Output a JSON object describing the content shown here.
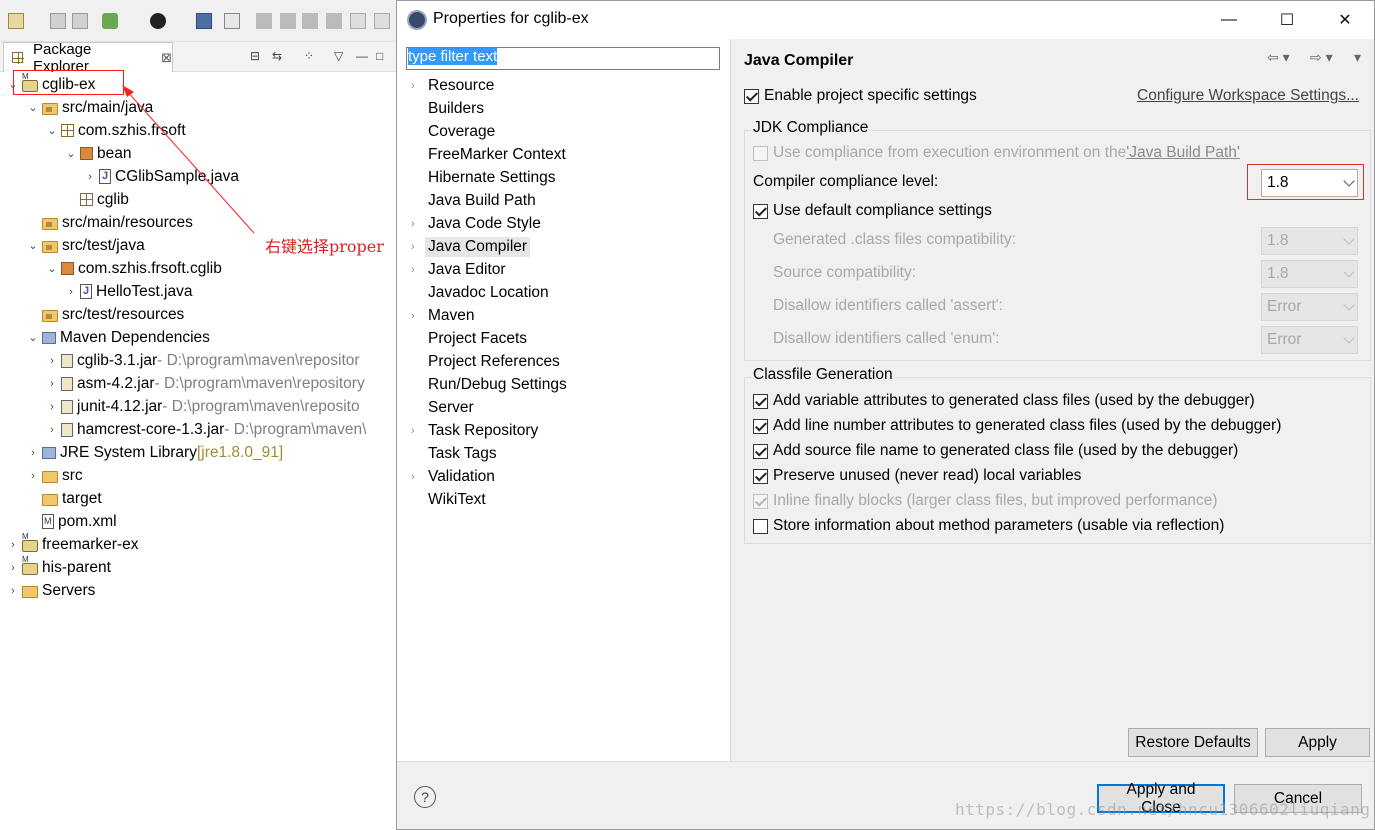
{
  "package_explorer": {
    "title": "Package Explorer",
    "close_glyph": "⊠",
    "tree": [
      {
        "label": "cglib-ex",
        "icon": "maven-project-icon",
        "twisty": "⌄"
      },
      {
        "label": "src/main/java",
        "icon": "source-folder-icon",
        "twisty": "⌄"
      },
      {
        "label": "com.szhis.frsoft",
        "icon": "package-icon",
        "twisty": "⌄"
      },
      {
        "label": "bean",
        "icon": "package-icon",
        "twisty": "⌄"
      },
      {
        "label": "CGlibSample.java",
        "icon": "java-file-icon",
        "twisty": "›"
      },
      {
        "label": "cglib",
        "icon": "package-icon",
        "twisty": ""
      },
      {
        "label": "src/main/resources",
        "icon": "source-folder-icon",
        "twisty": ""
      },
      {
        "label": "src/test/java",
        "icon": "source-folder-icon",
        "twisty": "⌄"
      },
      {
        "label": "com.szhis.frsoft.cglib",
        "icon": "package-icon",
        "twisty": "⌄"
      },
      {
        "label": "HelloTest.java",
        "icon": "java-file-icon",
        "twisty": "›"
      },
      {
        "label": "src/test/resources",
        "icon": "source-folder-icon",
        "twisty": ""
      },
      {
        "label": "Maven Dependencies",
        "icon": "library-icon",
        "twisty": "⌄"
      },
      {
        "label": "cglib-3.1.jar",
        "deco": " - D:\\program\\maven\\repositor",
        "icon": "jar-icon",
        "twisty": "›"
      },
      {
        "label": "asm-4.2.jar",
        "deco": " - D:\\program\\maven\\repository",
        "icon": "jar-icon",
        "twisty": "›"
      },
      {
        "label": "junit-4.12.jar",
        "deco": " - D:\\program\\maven\\reposito",
        "icon": "jar-icon",
        "twisty": "›"
      },
      {
        "label": "hamcrest-core-1.3.jar",
        "deco": " - D:\\program\\maven\\",
        "icon": "jar-icon",
        "twisty": "›"
      },
      {
        "label": "JRE System Library",
        "deco": " [jre1.8.0_91]",
        "icon": "library-icon",
        "twisty": "›"
      },
      {
        "label": "src",
        "icon": "folder-icon",
        "twisty": "›"
      },
      {
        "label": "target",
        "icon": "folder-icon",
        "twisty": ""
      },
      {
        "label": "pom.xml",
        "icon": "xml-file-icon",
        "twisty": ""
      },
      {
        "label": "freemarker-ex",
        "icon": "maven-project-icon",
        "twisty": "›"
      },
      {
        "label": "his-parent",
        "icon": "maven-project-icon",
        "twisty": "›"
      },
      {
        "label": "Servers",
        "icon": "folder-icon",
        "twisty": "›"
      }
    ]
  },
  "annotation": {
    "text": "右键选择proper",
    "color": "#e02020"
  },
  "dialog": {
    "title": "Properties for cglib-ex",
    "window_buttons": {
      "minimize": "—",
      "maximize": "☐",
      "close": "✕"
    },
    "filter": {
      "value": "type filter text"
    },
    "nav_items": [
      {
        "label": "Resource",
        "expandable": true
      },
      {
        "label": "Builders",
        "expandable": false
      },
      {
        "label": "Coverage",
        "expandable": false
      },
      {
        "label": "FreeMarker Context",
        "expandable": false
      },
      {
        "label": "Hibernate Settings",
        "expandable": false
      },
      {
        "label": "Java Build Path",
        "expandable": false
      },
      {
        "label": "Java Code Style",
        "expandable": true
      },
      {
        "label": "Java Compiler",
        "expandable": true,
        "selected": true
      },
      {
        "label": "Java Editor",
        "expandable": true
      },
      {
        "label": "Javadoc Location",
        "expandable": false
      },
      {
        "label": "Maven",
        "expandable": true
      },
      {
        "label": "Project Facets",
        "expandable": false
      },
      {
        "label": "Project References",
        "expandable": false
      },
      {
        "label": "Run/Debug Settings",
        "expandable": false
      },
      {
        "label": "Server",
        "expandable": false
      },
      {
        "label": "Task Repository",
        "expandable": true
      },
      {
        "label": "Task Tags",
        "expandable": false
      },
      {
        "label": "Validation",
        "expandable": true
      },
      {
        "label": "WikiText",
        "expandable": false
      }
    ],
    "page": {
      "heading": "Java Compiler",
      "enable_project_specific": {
        "label": "Enable project specific settings",
        "checked": true
      },
      "configure_link": "Configure Workspace Settings...",
      "jdk_group": {
        "title": "JDK Compliance",
        "use_env": {
          "prefix": "Use compliance from execution environment on the ",
          "link": "'Java Build Path'",
          "checked": false,
          "enabled": false
        },
        "compliance_label": "Compiler compliance level:",
        "compliance_value": "1.8",
        "use_default": {
          "label": "Use default compliance settings",
          "checked": true
        },
        "settings": [
          {
            "label": "Generated .class files compatibility:",
            "value": "1.8"
          },
          {
            "label": "Source compatibility:",
            "value": "1.8"
          },
          {
            "label": "Disallow identifiers called 'assert':",
            "value": "Error"
          },
          {
            "label": "Disallow identifiers called 'enum':",
            "value": "Error"
          }
        ]
      },
      "classfile_group": {
        "title": "Classfile Generation",
        "options": [
          {
            "label": "Add variable attributes to generated class files (used by the debugger)",
            "checked": true,
            "enabled": true
          },
          {
            "label": "Add line number attributes to generated class files (used by the debugger)",
            "checked": true,
            "enabled": true
          },
          {
            "label": "Add source file name to generated class file (used by the debugger)",
            "checked": true,
            "enabled": true
          },
          {
            "label": "Preserve unused (never read) local variables",
            "checked": true,
            "enabled": true
          },
          {
            "label": "Inline finally blocks (larger class files, but improved performance)",
            "checked": true,
            "enabled": false
          },
          {
            "label": "Store information about method parameters (usable via reflection)",
            "checked": false,
            "enabled": true
          }
        ]
      },
      "restore_defaults": "Restore Defaults",
      "apply": "Apply"
    },
    "help_glyph": "?",
    "apply_and_close": "Apply and Close",
    "cancel": "Cancel"
  },
  "watermark": "https://blog.csdn.net/hncu1306602liuqiang"
}
